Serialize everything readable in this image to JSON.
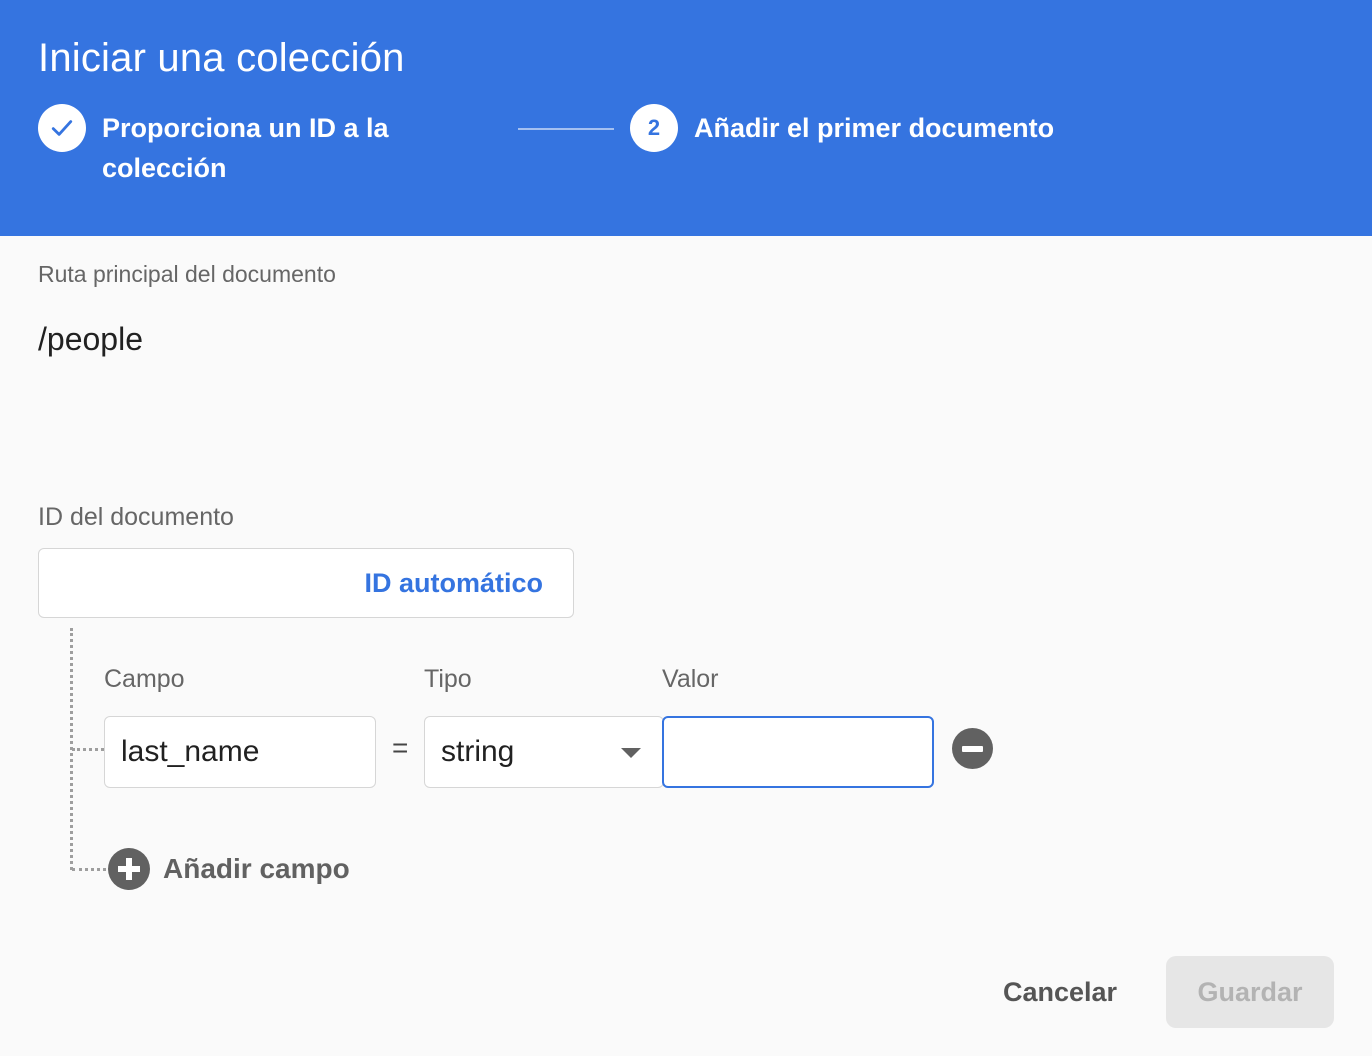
{
  "dialog": {
    "title": "Iniciar una colección"
  },
  "stepper": {
    "steps": [
      {
        "label": "Proporciona un ID a la colección",
        "state": "completed",
        "icon": "check-icon"
      },
      {
        "label": "Añadir el primer documento",
        "number": "2",
        "state": "active"
      }
    ]
  },
  "document_path": {
    "label": "Ruta principal del documento",
    "value": "/people"
  },
  "document_id": {
    "label": "ID del documento",
    "value": "",
    "auto_id_label": "ID automático"
  },
  "fields": {
    "headers": {
      "field": "Campo",
      "type": "Tipo",
      "value": "Valor"
    },
    "rows": [
      {
        "name": "last_name",
        "equals": "=",
        "type": "string",
        "value": ""
      }
    ],
    "add_field_label": "Añadir campo"
  },
  "actions": {
    "cancel_label": "Cancelar",
    "save_label": "Guardar",
    "save_enabled": false
  },
  "colors": {
    "primary": "#3574e0",
    "header_bg": "#3574e0",
    "icon_gray": "#616161",
    "disabled_bg": "#e6e6e6"
  }
}
